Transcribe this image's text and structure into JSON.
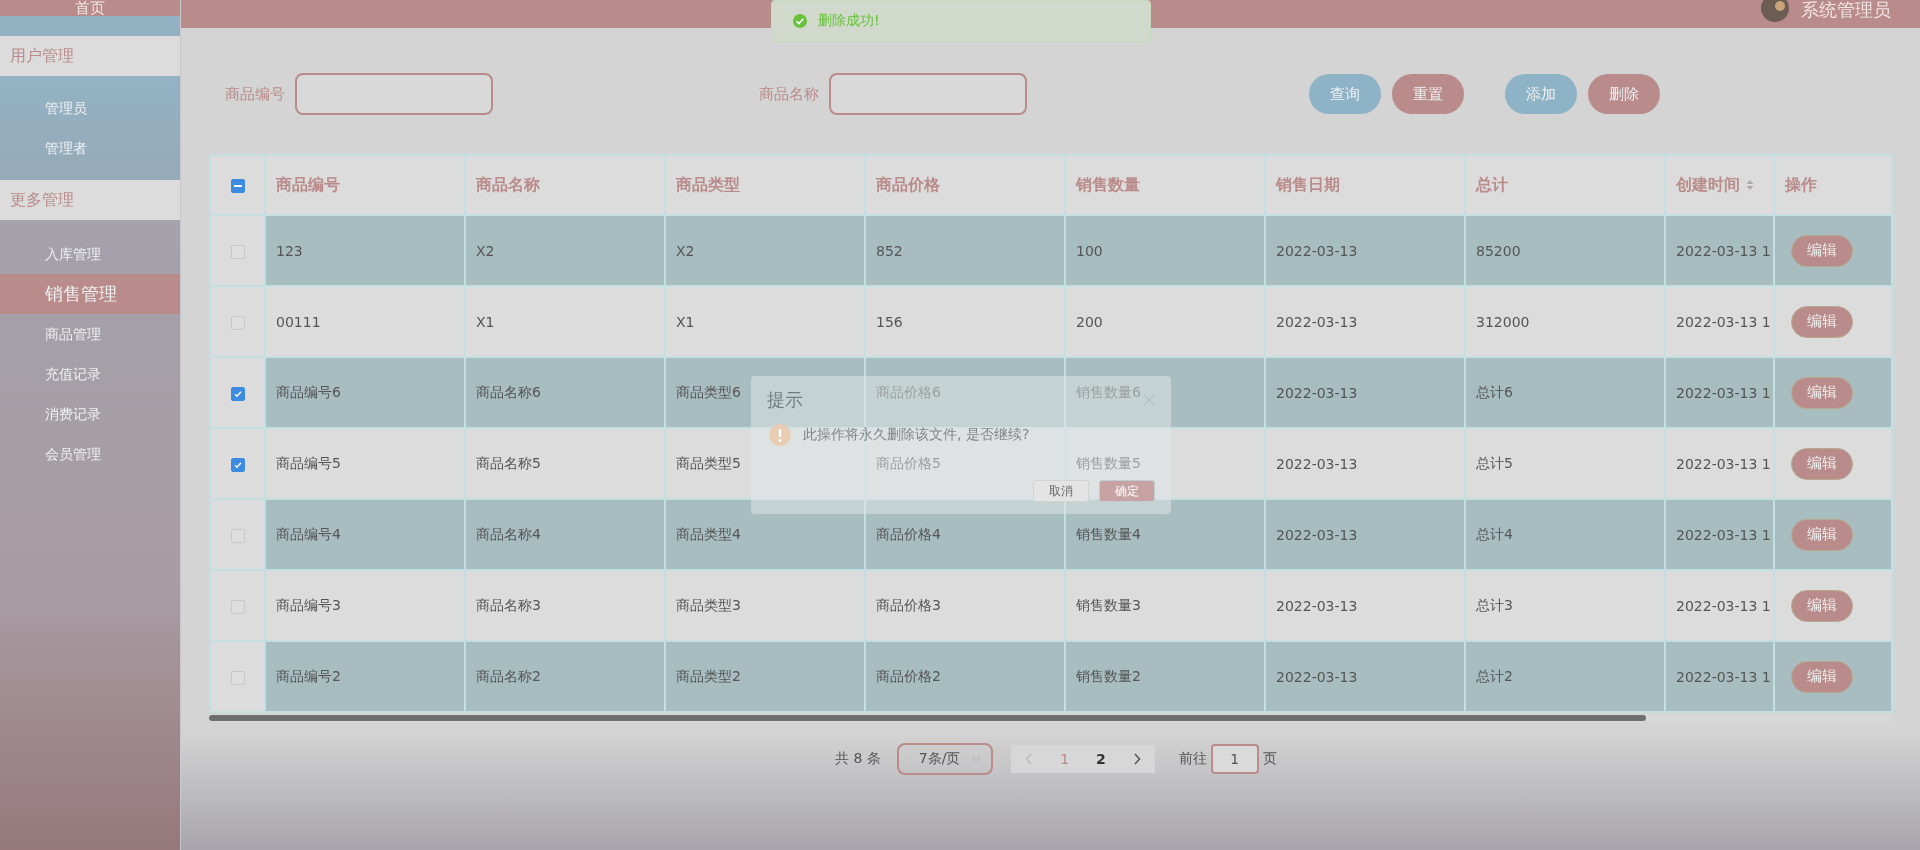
{
  "sidebar": {
    "top_item": "首页",
    "groups": [
      {
        "title": "用户管理",
        "items": [
          {
            "label": "管理员",
            "selected": false
          },
          {
            "label": "管理者",
            "selected": false
          }
        ]
      },
      {
        "title": "更多管理",
        "items": [
          {
            "label": "入库管理",
            "selected": false
          },
          {
            "label": "销售管理",
            "selected": true
          },
          {
            "label": "商品管理",
            "selected": false
          },
          {
            "label": "充值记录",
            "selected": false
          },
          {
            "label": "消费记录",
            "selected": false
          },
          {
            "label": "会员管理",
            "selected": false
          }
        ]
      }
    ]
  },
  "header": {
    "user": "系统管理员"
  },
  "toast": {
    "message": "删除成功!"
  },
  "search": {
    "fields": [
      {
        "label": "商品编号"
      },
      {
        "label": "商品名称"
      }
    ],
    "buttons": [
      {
        "label": "查询",
        "kind": "primary"
      },
      {
        "label": "重置",
        "kind": "danger"
      },
      {
        "label": "添加",
        "kind": "primary"
      },
      {
        "label": "删除",
        "kind": "danger"
      }
    ]
  },
  "table": {
    "header_checkbox": {
      "indeterminate": true
    },
    "columns": [
      {
        "label": "商品编号",
        "sortable": false
      },
      {
        "label": "商品名称",
        "sortable": false
      },
      {
        "label": "商品类型",
        "sortable": false
      },
      {
        "label": "商品价格",
        "sortable": false
      },
      {
        "label": "销售数量",
        "sortable": false
      },
      {
        "label": "销售日期",
        "sortable": false
      },
      {
        "label": "总计",
        "sortable": false
      },
      {
        "label": "创建时间",
        "sortable": true
      },
      {
        "label": "操作",
        "sortable": false
      }
    ],
    "rows": [
      {
        "checked": false,
        "cells": [
          "123",
          "X2",
          "X2",
          "852",
          "100",
          "2022-03-13",
          "85200",
          "2022-03-13 1"
        ],
        "action": "编辑"
      },
      {
        "checked": false,
        "cells": [
          "00111",
          "X1",
          "X1",
          "156",
          "200",
          "2022-03-13",
          "312000",
          "2022-03-13 1"
        ],
        "action": "编辑"
      },
      {
        "checked": true,
        "cells": [
          "商品编号6",
          "商品名称6",
          "商品类型6",
          "商品价格6",
          "销售数量6",
          "2022-03-13",
          "总计6",
          "2022-03-13 1"
        ],
        "action": "编辑"
      },
      {
        "checked": true,
        "cells": [
          "商品编号5",
          "商品名称5",
          "商品类型5",
          "商品价格5",
          "销售数量5",
          "2022-03-13",
          "总计5",
          "2022-03-13 1"
        ],
        "action": "编辑"
      },
      {
        "checked": false,
        "cells": [
          "商品编号4",
          "商品名称4",
          "商品类型4",
          "商品价格4",
          "销售数量4",
          "2022-03-13",
          "总计4",
          "2022-03-13 1"
        ],
        "action": "编辑"
      },
      {
        "checked": false,
        "cells": [
          "商品编号3",
          "商品名称3",
          "商品类型3",
          "商品价格3",
          "销售数量3",
          "2022-03-13",
          "总计3",
          "2022-03-13 1"
        ],
        "action": "编辑"
      },
      {
        "checked": false,
        "cells": [
          "商品编号2",
          "商品名称2",
          "商品类型2",
          "商品价格2",
          "销售数量2",
          "2022-03-13",
          "总计2",
          "2022-03-13 1"
        ],
        "action": "编辑"
      }
    ]
  },
  "dialog": {
    "title": "提示",
    "message": "此操作将永久删除该文件, 是否继续?",
    "buttons": [
      {
        "label": "取消",
        "kind": "cancel"
      },
      {
        "label": "确定",
        "kind": "confirm"
      }
    ]
  },
  "pagination": {
    "total": "共 8 条",
    "page_size": "7条/页",
    "pages": [
      {
        "label": "1",
        "selected": true
      },
      {
        "label": "2",
        "selected": false
      }
    ],
    "jump_label": "前往",
    "jump_value": "1",
    "jump_suffix": "页"
  }
}
